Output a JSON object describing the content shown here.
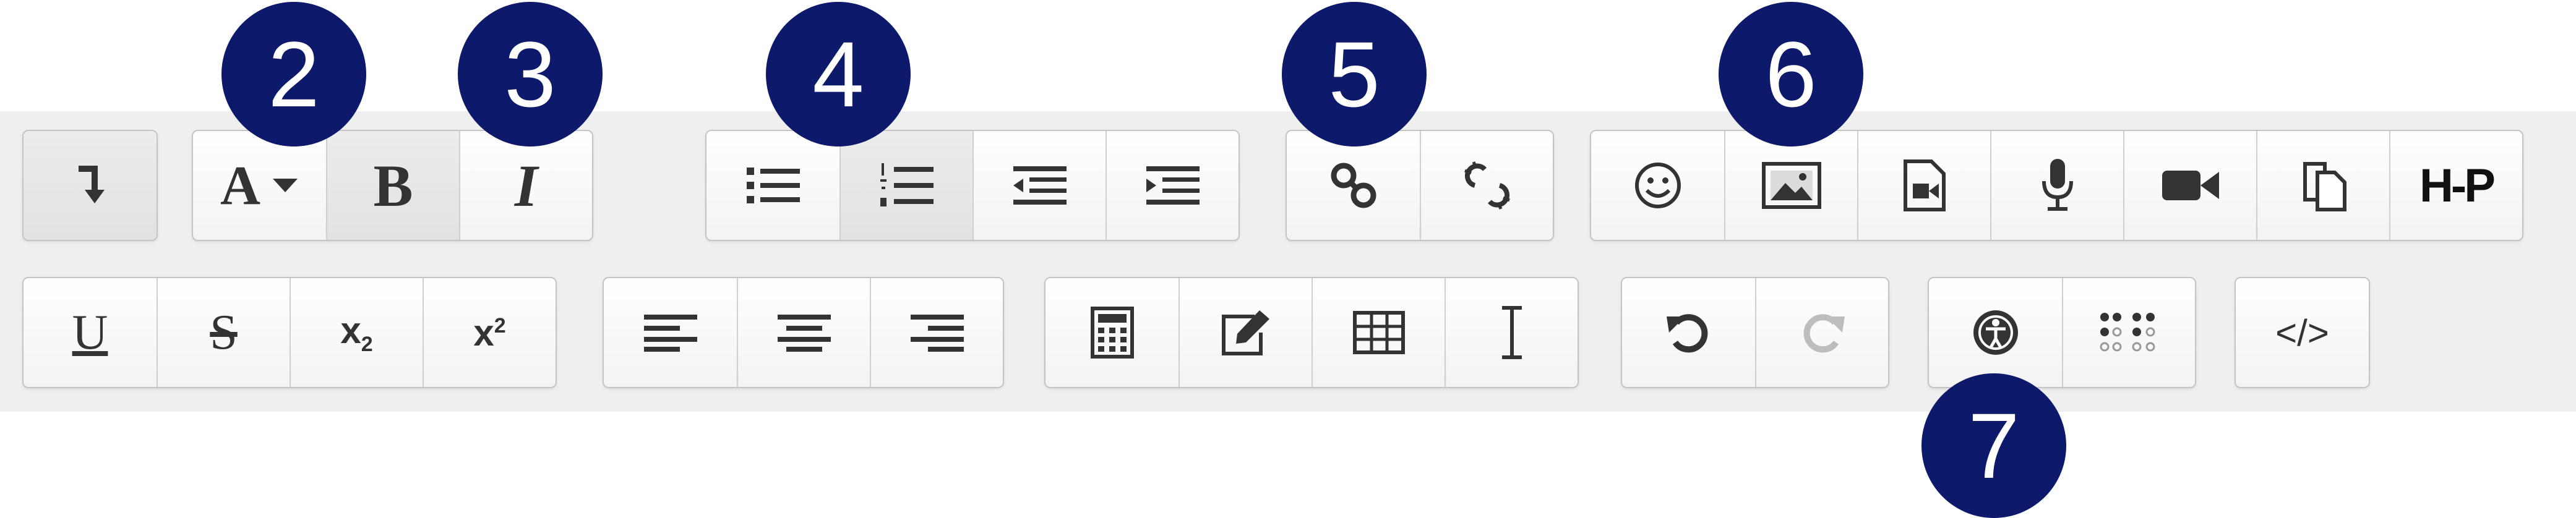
{
  "toolbar": {
    "row1": {
      "toggle_icon": "arrow-down-icon",
      "font_color": {
        "label": "A",
        "icon": "caret-down-icon"
      },
      "bold_label": "B",
      "italic_label": "I",
      "list_icons": [
        "unordered-list-icon",
        "ordered-list-icon",
        "outdent-icon",
        "indent-icon"
      ],
      "link_icons": [
        "link-icon",
        "unlink-icon"
      ],
      "media_icons": [
        "emoticon-icon",
        "image-icon",
        "media-file-icon",
        "microphone-icon",
        "video-camera-icon",
        "paste-icon"
      ],
      "h5p_label": "H-P"
    },
    "row2": {
      "underline_label": "U",
      "strike_label": "S",
      "subscript": {
        "base": "x",
        "sub": "2"
      },
      "superscript": {
        "base": "x",
        "sup": "2"
      },
      "align_icons": [
        "align-left-icon",
        "align-center-icon",
        "align-right-icon"
      ],
      "insert_icons": [
        "calculator-icon",
        "edit-icon",
        "table-icon",
        "text-cursor-icon"
      ],
      "history_icons": [
        "undo-icon",
        "redo-icon"
      ],
      "accessibility_icons": [
        "accessibility-icon",
        "braille-icon"
      ],
      "html_label": "</>"
    }
  },
  "badges": [
    "2",
    "3",
    "4",
    "5",
    "6",
    "7"
  ],
  "colors": {
    "badge": "#0d1a6b",
    "toolbar_background": "#efefef",
    "icon": "#333333",
    "disabled_icon": "#bdbdbd"
  }
}
